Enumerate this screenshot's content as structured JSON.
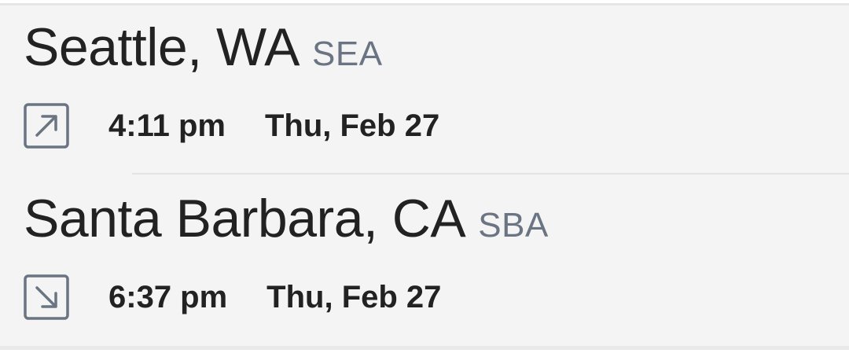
{
  "departure": {
    "city": "Seattle, WA",
    "code": "SEA",
    "icon": "arrow-up-right-icon",
    "time": "4:11 pm",
    "date": "Thu, Feb 27"
  },
  "arrival": {
    "city": "Santa Barbara, CA",
    "code": "SBA",
    "icon": "arrow-down-right-icon",
    "time": "6:37 pm",
    "date": "Thu, Feb 27"
  },
  "colors": {
    "text": "#222222",
    "code": "#6b7482",
    "icon": "#6b7482",
    "background": "#f4f4f4",
    "divider": "#e3e3e3"
  }
}
